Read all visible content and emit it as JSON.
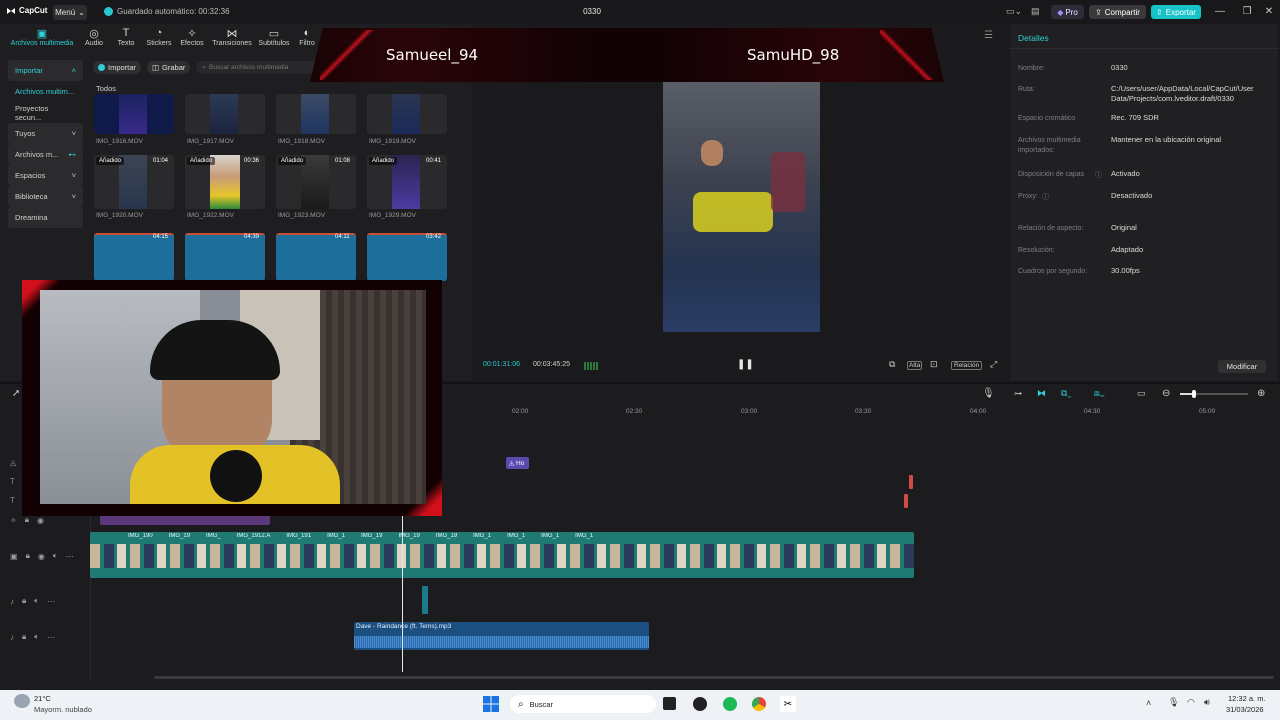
{
  "app": {
    "logo": "CapCut",
    "menu_label": "Menú",
    "autosave_text": "Guardado automático: 00:32:36",
    "project_title": "0330",
    "pro_label": "Pro",
    "share_label": "Compartir",
    "export_label": "Exportar"
  },
  "top_tabs": [
    {
      "label": "Archivos multimedia",
      "icon": "media-icon"
    },
    {
      "label": "Audio",
      "icon": "audio-icon"
    },
    {
      "label": "Texto",
      "icon": "text-icon"
    },
    {
      "label": "Stickers",
      "icon": "sticker-icon"
    },
    {
      "label": "Efectos",
      "icon": "effects-icon"
    },
    {
      "label": "Transiciones",
      "icon": "transitions-icon"
    },
    {
      "label": "Subtítulos",
      "icon": "subtitles-icon"
    },
    {
      "label": "Filtro",
      "icon": "filter-icon"
    }
  ],
  "sidebar": {
    "items": [
      {
        "label": "Importar"
      },
      {
        "label": "Archivos multim..."
      },
      {
        "label": "Proyectos secun..."
      },
      {
        "label": "Tuyos"
      },
      {
        "label": "Archivos m..."
      },
      {
        "label": "Espacios"
      },
      {
        "label": "Biblioteca"
      },
      {
        "label": "Dreamina"
      }
    ]
  },
  "media": {
    "import_label": "Importar",
    "record_label": "Grabar",
    "search_placeholder": "Buscar archivos multimedia",
    "all_label": "Todos",
    "added_label": "Añadido",
    "row1": [
      {
        "name": "IMG_1916.MOV"
      },
      {
        "name": "IMG_1917.MOV"
      },
      {
        "name": "IMG_1918.MOV"
      },
      {
        "name": "IMG_1919.MOV"
      }
    ],
    "row2": [
      {
        "name": "IMG_1920.MOV",
        "duration": "01:04"
      },
      {
        "name": "IMG_1922.MOV",
        "duration": "00:36"
      },
      {
        "name": "IMG_1923.MOV",
        "duration": "01:08"
      },
      {
        "name": "IMG_1929.MOV",
        "duration": "00:41"
      }
    ],
    "row3": [
      {
        "duration": "04:15"
      },
      {
        "duration": "04:39"
      },
      {
        "duration": "04:11"
      },
      {
        "duration": "03:42"
      }
    ]
  },
  "overlay": {
    "player1": "Samueel_94",
    "player2": "SamuHD_98"
  },
  "player": {
    "current_time": "00:01:31:06",
    "total_time": "00:03:45:25",
    "quality_label": "Alta",
    "ratio_label": "Relación"
  },
  "details": {
    "title": "Detalles",
    "rows": [
      {
        "label": "Nombre:",
        "value": "0330"
      },
      {
        "label": "Ruta:",
        "value": "C:/Users/user/AppData/Local/CapCut/User Data/Projects/com.lveditor.draft/0330"
      },
      {
        "label": "Espacio cromático",
        "value": "Rec. 709 SDR"
      },
      {
        "label": "Archivos multimedia importados:",
        "value": "Mantener en la ubicación original"
      },
      {
        "label": "Disposición de capas",
        "value": "Activado"
      },
      {
        "label": "Proxy:",
        "value": "Desactivado"
      },
      {
        "label": "Relación de aspecto:",
        "value": "Original"
      },
      {
        "label": "Resolución:",
        "value": "Adaptado"
      },
      {
        "label": "Cuadros por segundo:",
        "value": "30.00fps"
      }
    ],
    "modify_label": "Modificar"
  },
  "timeline": {
    "ruler": [
      "02:00",
      "02:30",
      "03:00",
      "03:30",
      "04:00",
      "04:30",
      "05:00"
    ],
    "text_clip": "Ho",
    "clip_labels": [
      "IMG_190",
      "IMG_19",
      "IMG_",
      "IMG_1912.A",
      "IMG_191",
      "IMG_1",
      "IMG_19",
      "IMG_19",
      "IMG_19",
      "IMG_1",
      "IMG_1",
      "IMG_1",
      "IMG_1"
    ],
    "audio_label": "Dave - Raindance (ft. Tems).mp3"
  },
  "taskbar": {
    "weather_temp": "21°C",
    "weather_desc": "Mayorm. nublado",
    "search_label": "Buscar",
    "time": "12:32 a. m.",
    "date": "31/03/2026"
  }
}
